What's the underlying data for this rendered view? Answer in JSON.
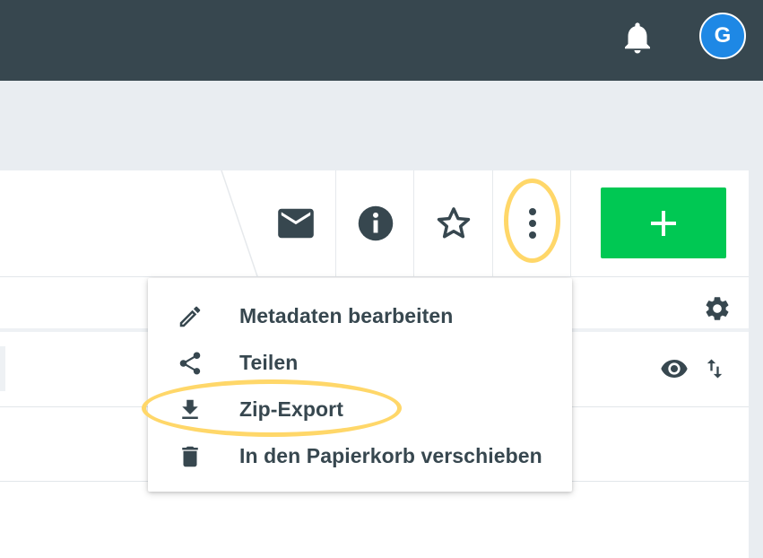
{
  "header": {
    "avatar_initial": "G",
    "icons": [
      "bell-icon"
    ]
  },
  "toolbar": {
    "icons": [
      "mail-icon",
      "info-icon",
      "star-outline-icon",
      "more-vertical-icon",
      "plus-icon"
    ]
  },
  "table": {
    "icons": [
      "gear-icon",
      "eye-icon",
      "sort-icon"
    ]
  },
  "context_menu": {
    "items": [
      {
        "label": "Metadaten bearbeiten",
        "icon": "pencil-icon"
      },
      {
        "label": "Teilen",
        "icon": "share-icon"
      },
      {
        "label": "Zip-Export",
        "icon": "download-icon"
      },
      {
        "label": "In den Papierkorb verschieben",
        "icon": "trash-icon"
      }
    ]
  },
  "colors": {
    "topbar": "#37474f",
    "avatar": "#1e88e5",
    "add_button": "#00c853",
    "highlight": "#ffd769",
    "icon": "#37474f"
  }
}
